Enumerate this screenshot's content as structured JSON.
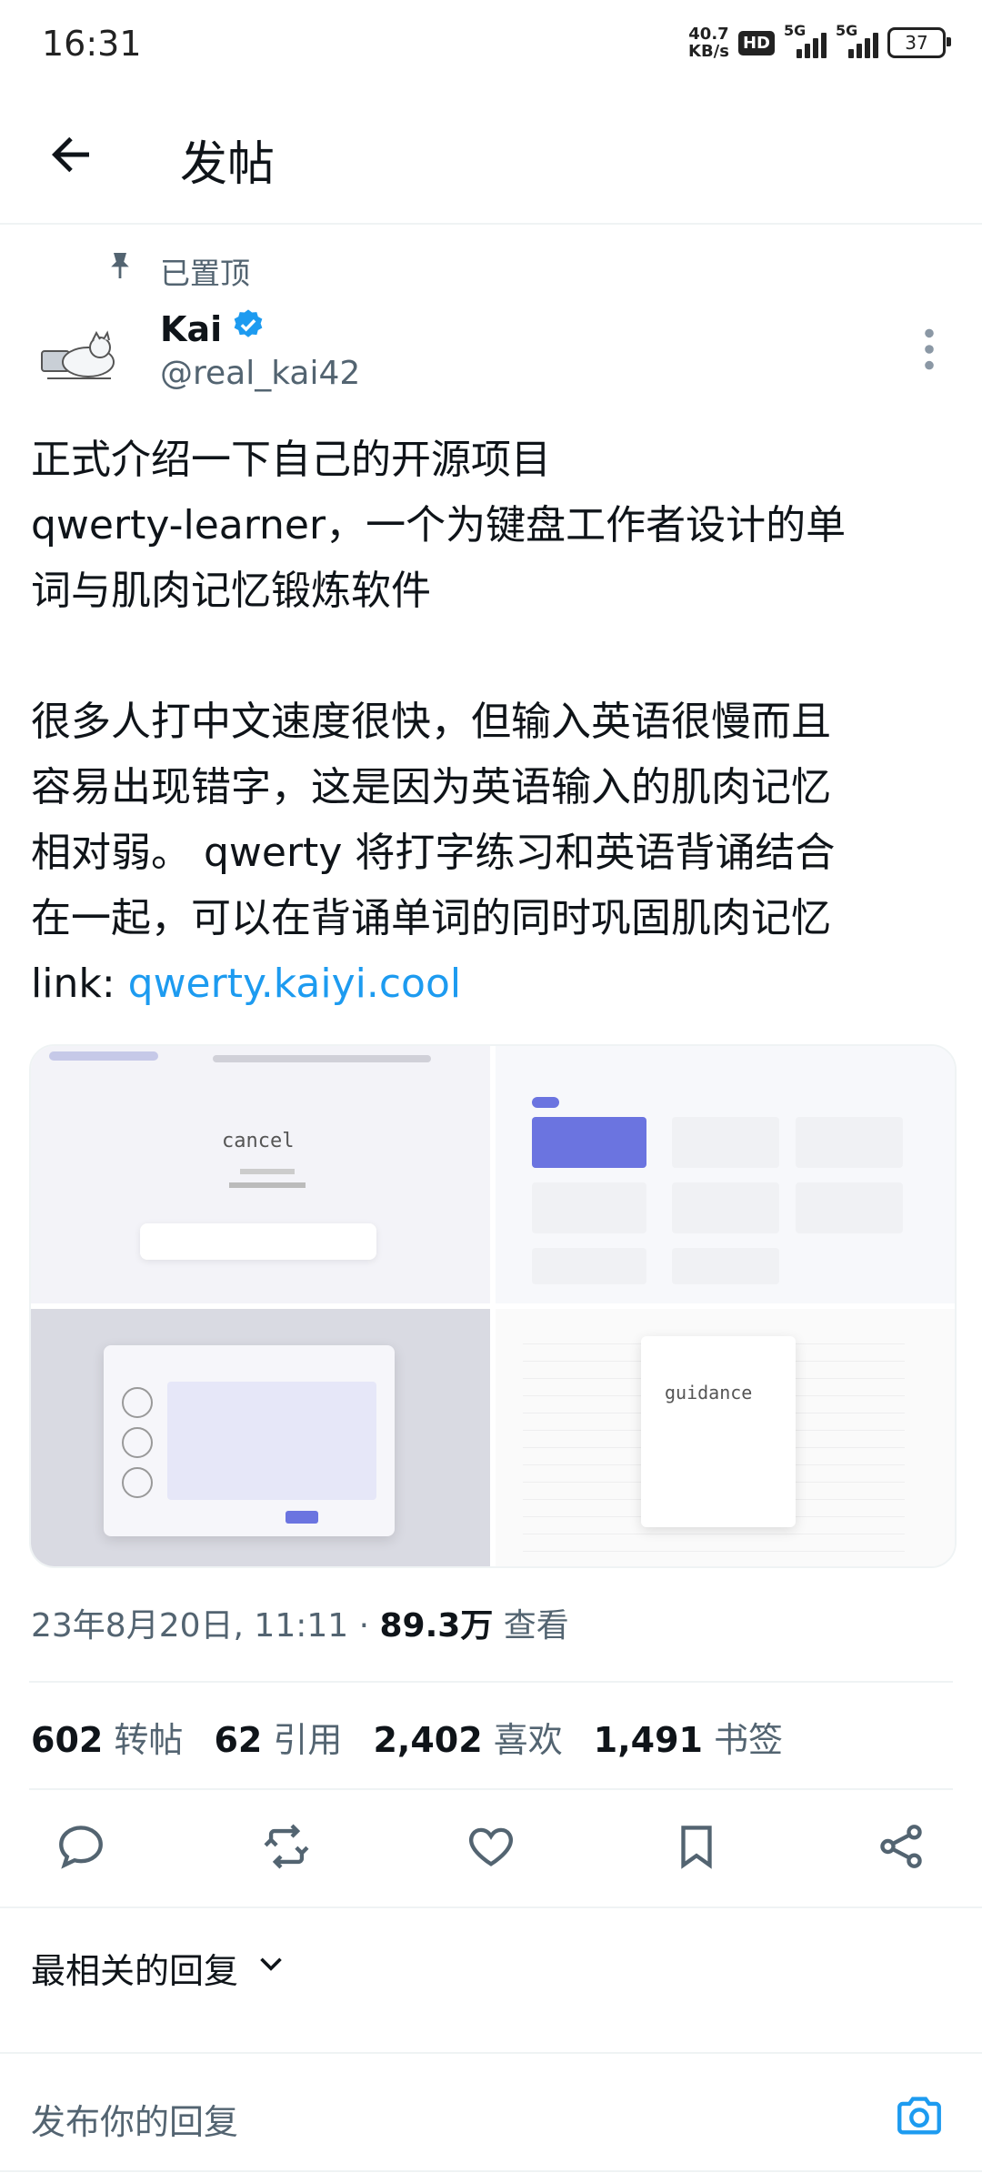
{
  "status_bar": {
    "time": "16:31",
    "net_speed_top": "40.7",
    "net_speed_bottom": "KB/s",
    "hd_label": "HD",
    "sig1_label": "5G",
    "sig2_label": "5G",
    "battery": "37"
  },
  "header": {
    "title": "发帖"
  },
  "post": {
    "pinned_label": "已置顶",
    "author_name": "Kai",
    "handle": "@real_kai42",
    "text_main": "正式介绍一下自己的开源项目\nqwerty-learner，一个为键盘工作者设计的单\n词与肌肉记忆锻炼软件\n\n很多人打中文速度很快，但输入英语很慢而且\n容易出现错字，这是因为英语输入的肌肉记忆\n相对弱。 qwerty 将打字练习和英语背诵结合\n在一起，可以在背诵单词的同时巩固肌肉记忆\nlink: ",
    "link_text": "qwerty.kaiyi.cool",
    "media_text": {
      "word1": "cancel",
      "word2": "guidance"
    },
    "timestamp": "23年8月20日, 11:11 · ",
    "views_count": "89.3万",
    "views_label": " 查看",
    "stats": {
      "reposts_count": "602",
      "reposts_label": "转帖",
      "quotes_count": "62",
      "quotes_label": "引用",
      "likes_count": "2,402",
      "likes_label": "喜欢",
      "bookmarks_count": "1,491",
      "bookmarks_label": "书签"
    }
  },
  "replies": {
    "sort_label": "最相关的回复",
    "reply_placeholder": "发布你的回复"
  },
  "colors": {
    "accent": "#1d9bf0",
    "secondary_text": "#536471",
    "divider": "#eff3f4"
  }
}
